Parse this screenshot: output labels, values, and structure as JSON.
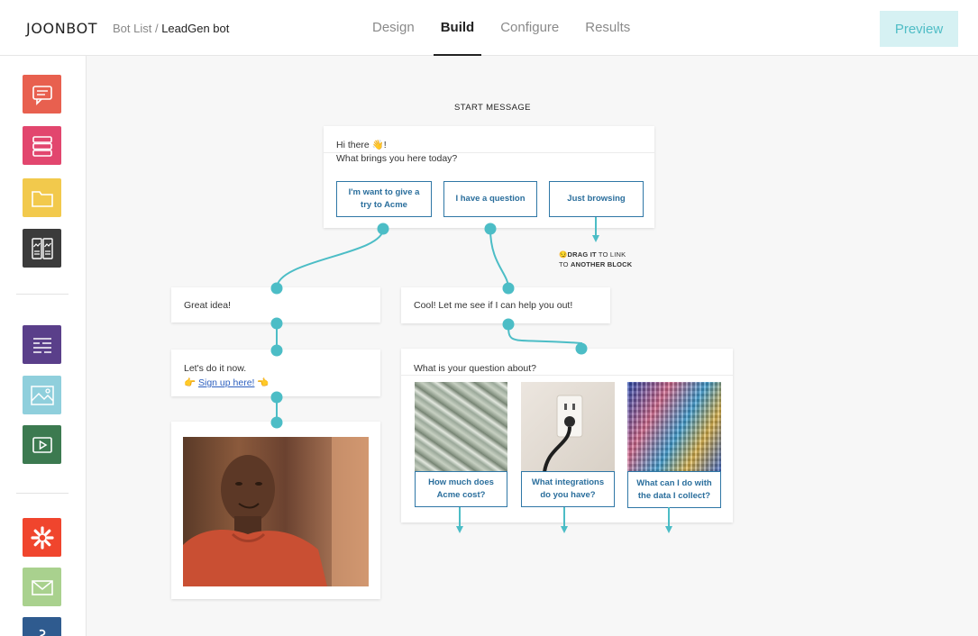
{
  "header": {
    "logo": "JOONBOT",
    "breadcrumb_parent": "Bot List /",
    "breadcrumb_current": "LeadGen bot",
    "tabs": [
      {
        "label": "Design"
      },
      {
        "label": "Build",
        "active": true
      },
      {
        "label": "Configure"
      },
      {
        "label": "Results"
      }
    ],
    "preview_label": "Preview"
  },
  "sidebar": {
    "tools": [
      {
        "icon": "message-icon",
        "color": "#e8604f"
      },
      {
        "icon": "list-icon",
        "color": "#e2466e"
      },
      {
        "icon": "folder-icon",
        "color": "#f2c94c"
      },
      {
        "icon": "card-gallery-icon",
        "color": "#3b3b3b"
      },
      {
        "icon": "form-fields-icon",
        "color": "#5a3f8a"
      },
      {
        "icon": "image-icon",
        "color": "#8fcfdc"
      },
      {
        "icon": "video-icon",
        "color": "#3c7a50"
      },
      {
        "icon": "zapier-icon",
        "color": "#f0452d"
      },
      {
        "icon": "email-icon",
        "color": "#a9d18e"
      },
      {
        "icon": "integration-icon",
        "color": "#2f5b8f"
      }
    ]
  },
  "canvas": {
    "start_label": "START MESSAGE",
    "start_block": {
      "line1": "Hi there 👋!",
      "line2": "What brings you here today?",
      "choices": [
        "I'm want to give a try to Acme",
        "I have a question",
        "Just browsing"
      ]
    },
    "hint": {
      "emoji": "😏",
      "bold1": "DRAG IT",
      "text1": " TO LINK",
      "text2": "TO ",
      "bold2": "ANOTHER BLOCK"
    },
    "great_idea": "Great idea!",
    "lets_do_it": {
      "line1": "Let's do it now.",
      "pre_emoji": "👉",
      "link": "Sign up here!",
      "post_emoji": "👈"
    },
    "cool_block": "Cool! Let me see if I can help you out!",
    "question_block": {
      "title": "What is your question about?",
      "cards": [
        {
          "label": "How much does Acme cost?"
        },
        {
          "label": "What integrations do you have?"
        },
        {
          "label": "What can I do with the data I collect?"
        }
      ]
    },
    "colors": {
      "connector": "#4cbdc6",
      "choice_border": "#2f77a6",
      "accent": "#4fbdc6"
    }
  }
}
